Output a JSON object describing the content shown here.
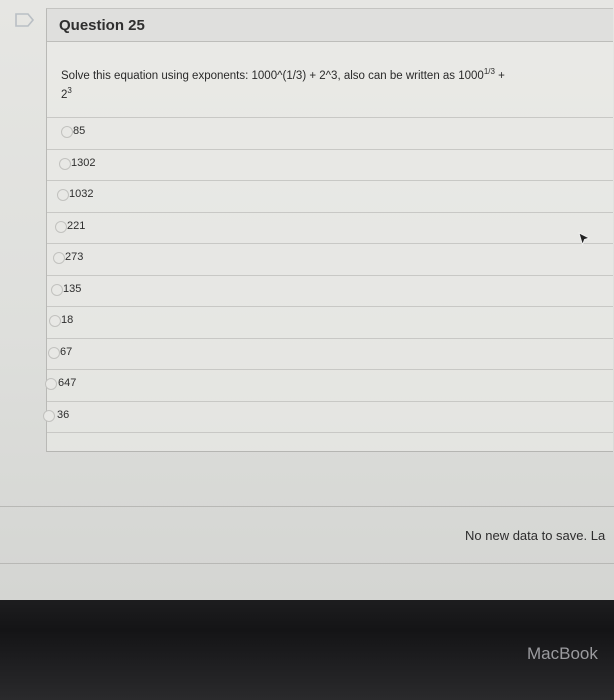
{
  "question": {
    "title": "Question 25",
    "prompt_main": "Solve this equation using exponents:  1000^(1/3) + 2^3, also can be written as 1000",
    "prompt_sup1": "1/3",
    "prompt_plus": " +",
    "prompt_base2": "2",
    "prompt_sup2": "3"
  },
  "options": [
    "85",
    "1302",
    "1032",
    "221",
    "273",
    "135",
    "18",
    "67",
    "647",
    "36"
  ],
  "status": {
    "message": "No new data to save. La"
  },
  "bezel": {
    "brand": "MacBook"
  },
  "colors": {
    "screen_bg": "#e3e3e0",
    "bezel": "#161618",
    "flag_stroke": "#b9bfc4"
  }
}
